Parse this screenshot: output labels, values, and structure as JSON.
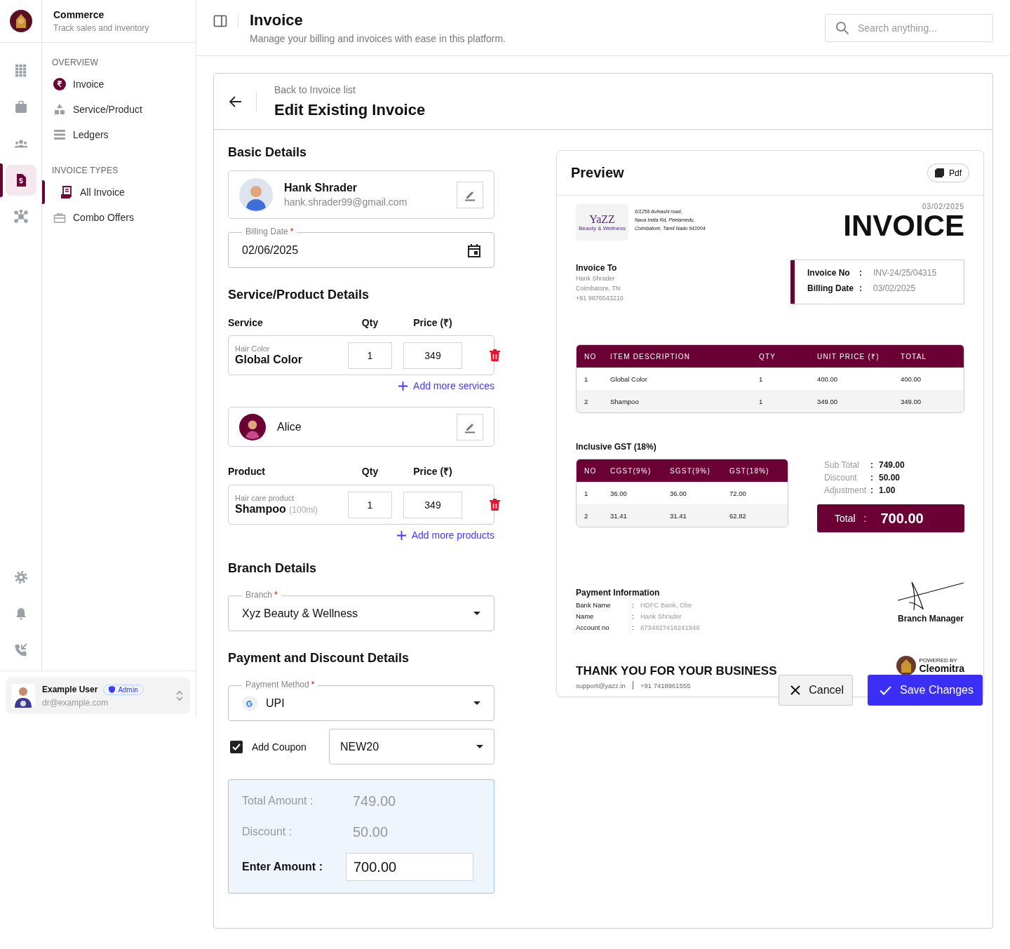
{
  "brand": {
    "title": "Commerce",
    "subtitle": "Track sales and inventory"
  },
  "rail": {
    "top": [
      {
        "selected": false
      },
      {
        "selected": false
      },
      {
        "selected": false
      },
      {
        "selected": true
      },
      {
        "selected": false
      }
    ],
    "bottom": [
      {
        "selected": false
      },
      {
        "selected": false
      },
      {
        "selected": false
      }
    ]
  },
  "sidebar": {
    "sections": [
      {
        "title": "OVERVIEW",
        "items": [
          {
            "label": "Invoice",
            "selected": false
          },
          {
            "label": "Service/Product",
            "selected": false
          },
          {
            "label": "Ledgers",
            "selected": false
          }
        ]
      },
      {
        "title": "INVOICE TYPES",
        "items": [
          {
            "label": "All Invoice",
            "selected": true
          },
          {
            "label": "Combo Offers",
            "selected": false
          }
        ]
      }
    ]
  },
  "user": {
    "name": "Example User",
    "role": "Admin",
    "email": "dr@example.com"
  },
  "header": {
    "title": "Invoice",
    "subtitle": "Manage your billing and invoices with ease in this platform.",
    "search": {
      "placeholder": "Search anything..."
    }
  },
  "page": {
    "back_label": "Back to Invoice list",
    "title": "Edit Existing Invoice"
  },
  "form": {
    "basic": {
      "title": "Basic Details",
      "customer": {
        "name": "Hank Shrader",
        "email": "hank.shrader99@gmail.com"
      },
      "billing_date": {
        "label": "Billing Date",
        "mark": "*",
        "value": "02/06/2025"
      }
    },
    "items": {
      "title": "Service/Product Details",
      "service_columns": [
        "Service",
        "Qty",
        "Price (₹)"
      ],
      "services": [
        {
          "category": "Hair Color",
          "name": "Global Color",
          "qty": "1",
          "price": "349"
        }
      ],
      "add_service": "Add more services",
      "staff": {
        "name": "Alice"
      },
      "product_columns": [
        "Product",
        "Qty",
        "Price (₹)"
      ],
      "products": [
        {
          "category": "Hair care product",
          "name": "Shampoo",
          "variant": "(100ml)",
          "qty": "1",
          "price": "349"
        }
      ],
      "add_product": "Add more products"
    },
    "branch": {
      "title": "Branch Details",
      "field": {
        "label": "Branch",
        "mark": "*",
        "value": "Xyz Beauty & Wellness"
      }
    },
    "payment": {
      "title": "Payment and Discount Details",
      "method": {
        "label": "Payment Method",
        "mark": "*",
        "value": "UPI"
      },
      "coupon": {
        "label": "Add Coupon",
        "checked": true,
        "value": "NEW20"
      },
      "summary": [
        {
          "label": "Total Amount :",
          "value": "749.00",
          "kind": "readonly"
        },
        {
          "label": "Discount :",
          "value": "50.00",
          "kind": "readonly"
        },
        {
          "label": "Enter Amount :",
          "value": "700.00",
          "kind": "input"
        }
      ]
    }
  },
  "preview": {
    "title": "Preview",
    "pdf_button": "Pdf",
    "logo": {
      "name": "YaZZ",
      "tagline": "Beauty & Wellness"
    },
    "address": [
      "6/1256 Avinashi road,",
      "Nava India Rd, Peelamedu,",
      "Coimbatore, Tamil Nadu 641004"
    ],
    "date": "03/02/2025",
    "heading": "INVOICE",
    "bill_to": {
      "title": "Invoice To",
      "lines": [
        "Hank Shrader",
        "Coimbatore, TN",
        "+91 9876543210"
      ]
    },
    "meta": [
      {
        "label": "Invoice No",
        "sep": ":",
        "value": "INV-24/25/04315"
      },
      {
        "label": "Billing Date",
        "sep": ":",
        "value": "03/02/2025"
      }
    ],
    "items_table": {
      "columns": [
        "NO",
        "ITEM DESCRIPTION",
        "QTY",
        "UNIT PRICE (₹)",
        "TOTAL"
      ],
      "rows": [
        [
          "1",
          "Global Color",
          "1",
          "400.00",
          "400.00"
        ],
        [
          "2",
          "Shampoo",
          "1",
          "349.00",
          "349.00"
        ]
      ]
    },
    "gst": {
      "title": "Inclusive GST (18%)",
      "columns": [
        "NO",
        "CGST(9%)",
        "SGST(9%)",
        "GST(18%)"
      ],
      "rows": [
        [
          "1",
          "36.00",
          "36.00",
          "72.00"
        ],
        [
          "2",
          "31.41",
          "31.41",
          "62.82"
        ]
      ]
    },
    "totals": [
      {
        "label": "Sub Total",
        "sep": ":",
        "value": "749.00"
      },
      {
        "label": "Discount",
        "sep": ":",
        "value": "50.00"
      },
      {
        "label": "Adjustment",
        "sep": ":",
        "value": "1.00"
      }
    ],
    "grand_total": {
      "label": "Total",
      "sep": ":",
      "value": "700.00"
    },
    "payment_info": {
      "title": "Payment Information",
      "rows": [
        {
          "label": "Bank Name",
          "sep": ":",
          "value": "HDFC Bank, Cbe"
        },
        {
          "label": "Name",
          "sep": ":",
          "value": "Hank Shrader"
        },
        {
          "label": "Account no",
          "sep": ":",
          "value": "8734827416241946"
        }
      ]
    },
    "signature": "Branch Manager",
    "footer": {
      "thanks": "THANK YOU FOR YOUR BUSINESS",
      "email": "support@yazz.in",
      "phone": "+91 7418961555"
    },
    "powered": {
      "caption": "POWERED BY",
      "name": "Cleomitra"
    }
  },
  "actions": [
    {
      "label": "Cancel",
      "kind": "secondary"
    },
    {
      "label": "Save Changes",
      "kind": "primary"
    }
  ]
}
